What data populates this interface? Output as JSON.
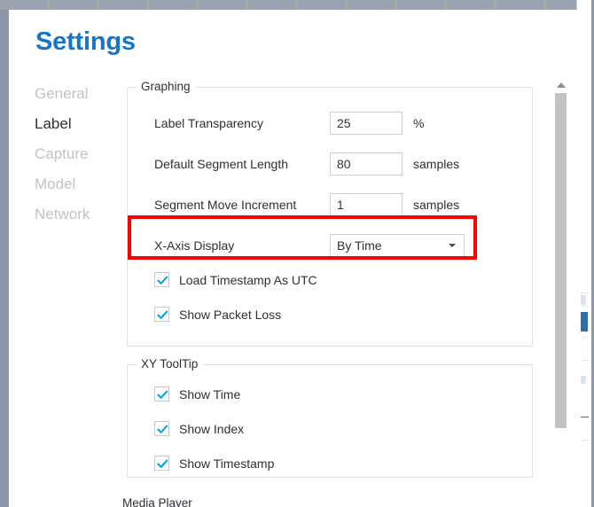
{
  "window": {
    "page_title": "Settings"
  },
  "sidebar": {
    "items": [
      {
        "label": "General",
        "active": false
      },
      {
        "label": "Label",
        "active": true
      },
      {
        "label": "Capture",
        "active": false
      },
      {
        "label": "Model",
        "active": false
      },
      {
        "label": "Network",
        "active": false
      }
    ]
  },
  "groups": {
    "graphing": {
      "legend": "Graphing",
      "fields": [
        {
          "label": "Label Transparency",
          "value": "25",
          "unit": "%"
        },
        {
          "label": "Default Segment Length",
          "value": "80",
          "unit": "samples"
        },
        {
          "label": "Segment Move Increment",
          "value": "1",
          "unit": "samples"
        }
      ],
      "dropdown": {
        "label": "X-Axis Display",
        "value": "By Time",
        "arrow_icon": "chevron-down-icon"
      },
      "checkboxes": [
        {
          "label": "Load Timestamp As UTC",
          "checked": true
        },
        {
          "label": "Show Packet Loss",
          "checked": true
        }
      ]
    },
    "xy_tooltip": {
      "legend": "XY ToolTip",
      "checkboxes": [
        {
          "label": "Show Time",
          "checked": true
        },
        {
          "label": "Show Index",
          "checked": true
        },
        {
          "label": "Show Timestamp",
          "checked": true
        }
      ]
    },
    "cut_off_group": {
      "legend": "Media Player"
    }
  },
  "scrollbar": {
    "up_arrow_icon": "scroll-up-arrow-icon",
    "thumb_name": "scrollbar-thumb"
  },
  "annotation": {
    "name": "red-highlight-box",
    "color": "#ff0000",
    "target": "X-Axis Display"
  },
  "colors": {
    "title_blue": "#1575c8",
    "check_blue": "#00a2e8",
    "text": "#2b3137",
    "nav_inactive": "#c3c3c3",
    "group_border": "#dfe3e7",
    "field_border": "#cfcfcf",
    "scrollbar_thumb": "#c2c2c2",
    "desktop": "#8d98a7"
  }
}
